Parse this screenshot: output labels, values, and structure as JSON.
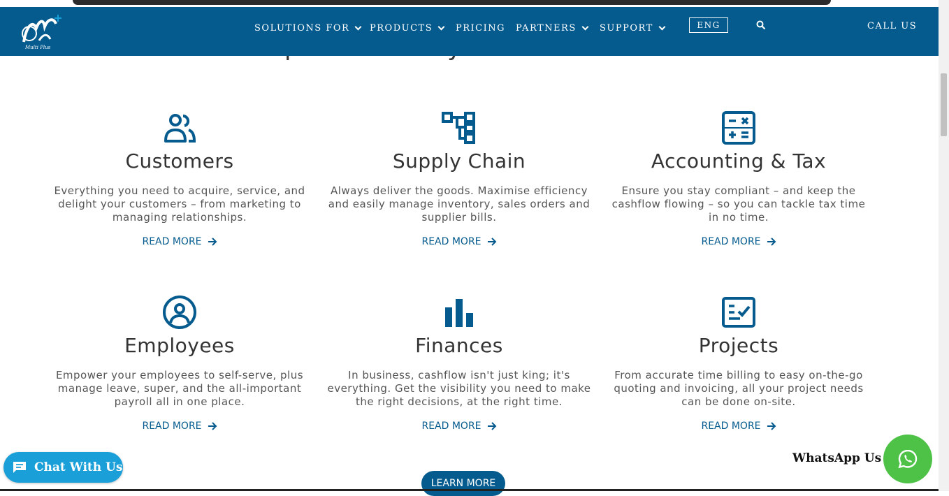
{
  "headline": "One platform. All your business needs.",
  "logo": {
    "text": "Multi Plus"
  },
  "nav": {
    "items": [
      {
        "label": "SOLUTIONS FOR",
        "dropdown": true
      },
      {
        "label": "PRODUCTS",
        "dropdown": true
      },
      {
        "label": "PRICING",
        "dropdown": false
      },
      {
        "label": "PARTNERS",
        "dropdown": true
      },
      {
        "label": "SUPPORT",
        "dropdown": true
      }
    ],
    "language": "ENG",
    "call_us": "CALL US"
  },
  "cards": [
    {
      "icon": "users-icon",
      "title": "Customers",
      "description": "Everything you need to acquire, service, and delight your customers – from marketing to managing relationships.",
      "link": "READ MORE"
    },
    {
      "icon": "workflow-icon",
      "title": "Supply Chain",
      "description": "Always deliver the goods. Maximise efficiency and easily manage inventory, sales orders and supplier bills.",
      "link": "READ MORE"
    },
    {
      "icon": "calculator-icon",
      "title": "Accounting & Tax",
      "description": "Ensure you stay compliant – and keep the cashflow flowing – so you can tackle tax time in no time.",
      "link": "READ MORE"
    },
    {
      "icon": "user-circle-icon",
      "title": "Employees",
      "description": "Empower your employees to self-serve, plus manage leave, super, and the all-important payroll all in one place.",
      "link": "READ MORE"
    },
    {
      "icon": "bar-chart-icon",
      "title": "Finances",
      "description": "In business, cashflow isn't just king; it's everything. Get the visibility you need to make the right decisions, at the right time.",
      "link": "READ MORE"
    },
    {
      "icon": "checklist-icon",
      "title": "Projects",
      "description": "From accurate time billing to easy on-the-go quoting and invoicing, all your project needs can be done on-site.",
      "link": "READ MORE"
    }
  ],
  "learn_more": "LEARN MORE",
  "chat": {
    "label": "Chat With Us"
  },
  "whatsapp": {
    "label": "WhatsApp Us"
  },
  "colors": {
    "brand": "#055b8e",
    "chat": "#1a9fd8",
    "whatsapp": "#4dc247"
  }
}
